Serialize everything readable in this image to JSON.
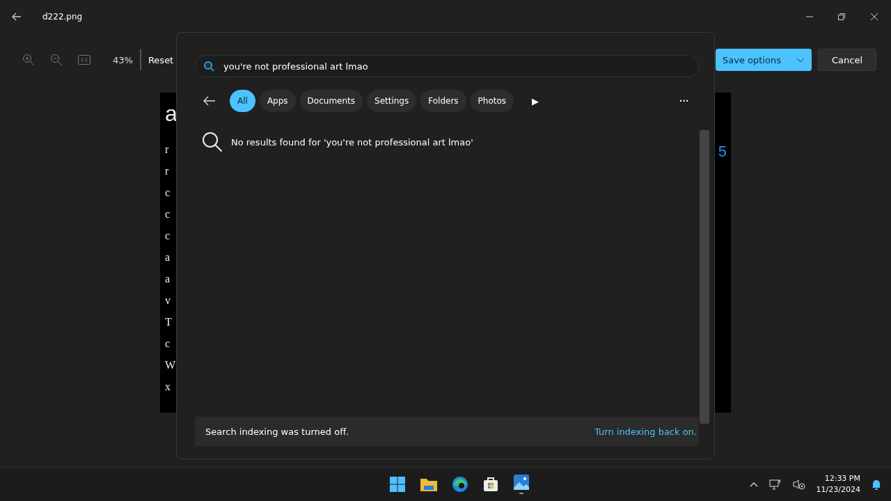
{
  "window": {
    "title": "d222.png"
  },
  "toolbar": {
    "zoom": "43%",
    "reset": "Reset",
    "save": "Save options",
    "cancel": "Cancel"
  },
  "image": {
    "left_letters": [
      "a",
      "r",
      "r",
      "c",
      "c",
      "c",
      "a",
      "a",
      "v",
      "T",
      "c",
      "W",
      "x"
    ],
    "right_text": "5"
  },
  "search": {
    "value": "you're not professional art lmao",
    "filters": [
      {
        "label": "All",
        "selected": true
      },
      {
        "label": "Apps",
        "selected": false
      },
      {
        "label": "Documents",
        "selected": false
      },
      {
        "label": "Settings",
        "selected": false
      },
      {
        "label": "Folders",
        "selected": false
      },
      {
        "label": "Photos",
        "selected": false
      }
    ],
    "play": "▶",
    "more": "···",
    "message": "No results found for 'you're not professional art lmao'",
    "footer": {
      "text": "Search indexing was turned off.",
      "link": "Turn indexing back on."
    }
  },
  "taskbar": {
    "time": "12:33 PM",
    "date": "11/23/2024"
  }
}
